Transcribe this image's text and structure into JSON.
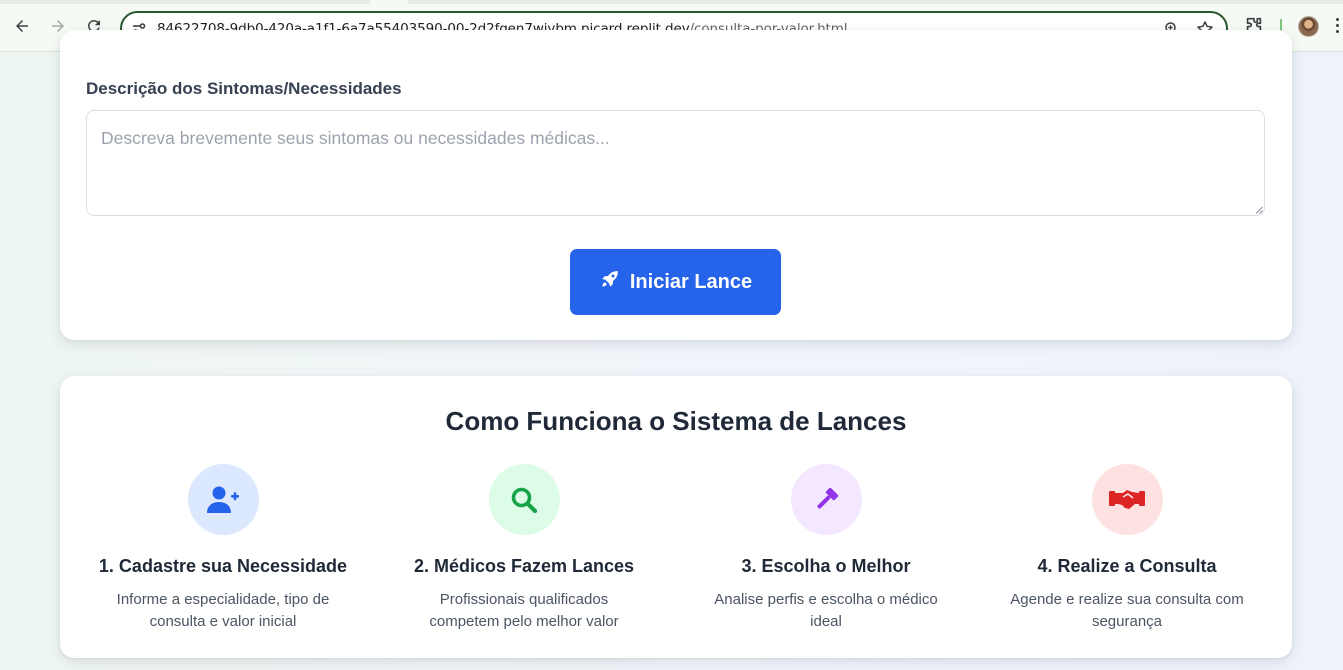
{
  "browser": {
    "url_host": "84622708-9db0-420a-a1f1-6a7a55403590-00-2d2fgen7wjybm.picard.replit.dev",
    "url_path": "/consulta-por-valor.html",
    "icons": [
      "back-arrow-icon",
      "forward-arrow-icon",
      "reload-icon",
      "site-info-icon",
      "zoom-icon",
      "bookmark-star-icon",
      "extensions-icon",
      "profile-avatar",
      "menu-kebab-icon"
    ]
  },
  "form": {
    "symptoms_label": "Descrição dos Sintomas/Necessidades",
    "symptoms_placeholder": "Descreva brevemente seus sintomas ou necessidades médicas...",
    "symptoms_value": "",
    "submit_label": "Iniciar Lance",
    "submit_icon": "rocket-icon",
    "submit_color": "#2563eb"
  },
  "how_it_works": {
    "title": "Como Funciona o Sistema de Lances",
    "steps": [
      {
        "title": "1. Cadastre sua Necessidade",
        "description": "Informe a especialidade, tipo de consulta e valor inicial",
        "icon": "user-plus-icon",
        "color": "#2563eb",
        "bg": "#dbe8fe"
      },
      {
        "title": "2. Médicos Fazem Lances",
        "description": "Profissionais qualificados competem pelo melhor valor",
        "icon": "search-icon",
        "color": "#16a34a",
        "bg": "#dcfce7"
      },
      {
        "title": "3. Escolha o Melhor",
        "description": "Analise perfis e escolha o médico ideal",
        "icon": "gavel-icon",
        "color": "#9333ea",
        "bg": "#f3e8ff"
      },
      {
        "title": "4. Realize a Consulta",
        "description": "Agende e realize sua consulta com segurança",
        "icon": "handshake-icon",
        "color": "#dc2626",
        "bg": "#fee2e2"
      }
    ]
  }
}
